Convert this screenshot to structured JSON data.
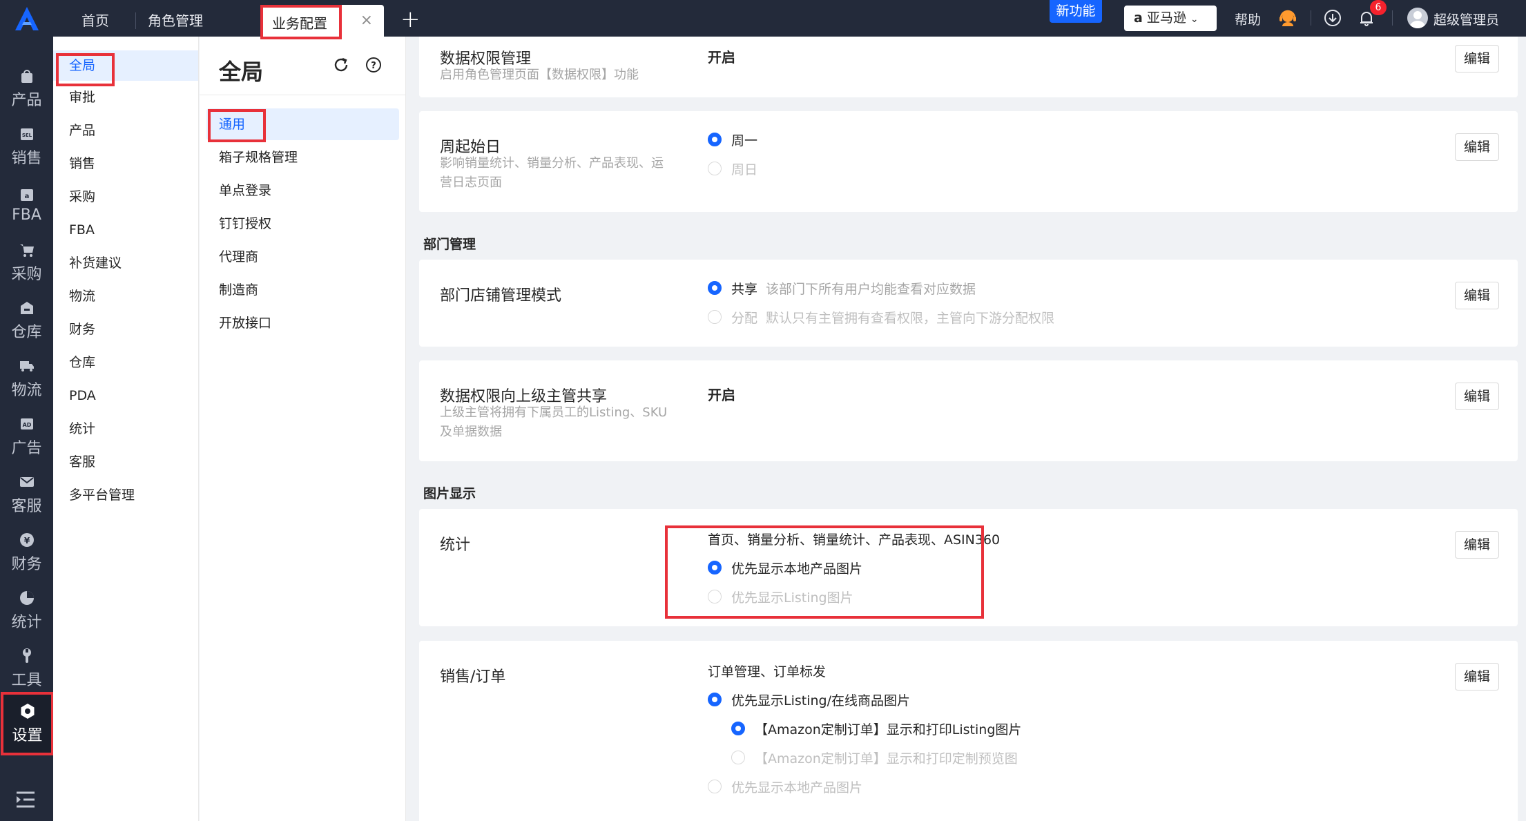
{
  "topbar": {
    "tabs": [
      {
        "label": "首页"
      },
      {
        "label": "角色管理"
      },
      {
        "label": "业务配置",
        "active": true
      }
    ],
    "add_tab": "+",
    "close_tab": "×",
    "new_feature": "新功能",
    "store": "亚马逊",
    "help": "帮助",
    "notification_count": "6",
    "user": "超级管理员"
  },
  "iconnav": {
    "items": [
      {
        "label": "产品",
        "icon": "bag-icon"
      },
      {
        "label": "销售",
        "icon": "sell-icon"
      },
      {
        "label": "FBA",
        "icon": "fba-icon"
      },
      {
        "label": "采购",
        "icon": "cart-icon"
      },
      {
        "label": "仓库",
        "icon": "warehouse-icon"
      },
      {
        "label": "物流",
        "icon": "truck-icon"
      },
      {
        "label": "广告",
        "icon": "ad-icon"
      },
      {
        "label": "客服",
        "icon": "mail-icon"
      },
      {
        "label": "财务",
        "icon": "yen-icon"
      },
      {
        "label": "统计",
        "icon": "pie-icon"
      },
      {
        "label": "工具",
        "icon": "wrench-icon"
      },
      {
        "label": "设置",
        "icon": "gear-icon",
        "active": true
      }
    ]
  },
  "col2": {
    "items": [
      "全局",
      "审批",
      "产品",
      "销售",
      "采购",
      "FBA",
      "补货建议",
      "物流",
      "财务",
      "仓库",
      "PDA",
      "统计",
      "客服",
      "多平台管理"
    ]
  },
  "col3": {
    "title": "全局",
    "items": [
      "通用",
      "箱子规格管理",
      "单点登录",
      "钉钉授权",
      "代理商",
      "制造商",
      "开放接口"
    ]
  },
  "main": {
    "edit_label": "编辑",
    "card1": {
      "title": "数据权限管理",
      "desc": "启用角色管理页面【数据权限】功能",
      "value": "开启"
    },
    "card2": {
      "title": "周起始日",
      "desc": "影响销量统计、销量分析、产品表现、运营日志页面",
      "opt1": "周一",
      "opt2": "周日"
    },
    "section_dept": "部门管理",
    "card3": {
      "title": "部门店铺管理模式",
      "opt1": "共享",
      "opt1_desc": "该部门下所有用户均能查看对应数据",
      "opt2": "分配",
      "opt2_desc": "默认只有主管拥有查看权限，主管向下游分配权限"
    },
    "card4": {
      "title": "数据权限向上级主管共享",
      "desc": "上级主管将拥有下属员工的Listing、SKU及单据数据",
      "value": "开启"
    },
    "section_img": "图片显示",
    "card5": {
      "title": "统计",
      "scope": "首页、销量分析、销量统计、产品表现、ASIN360",
      "opt1": "优先显示本地产品图片",
      "opt2": "优先显示Listing图片"
    },
    "card6": {
      "title": "销售/订单",
      "scope": "订单管理、订单标发",
      "opt1": "优先显示Listing/在线商品图片",
      "opt1a": "【Amazon定制订单】显示和打印Listing图片",
      "opt1b": "【Amazon定制订单】显示和打印定制预览图",
      "opt2": "优先显示本地产品图片"
    }
  },
  "colors": {
    "accent": "#1665ff",
    "nav_bg": "#232a3a",
    "highlight": "#e8313a"
  }
}
